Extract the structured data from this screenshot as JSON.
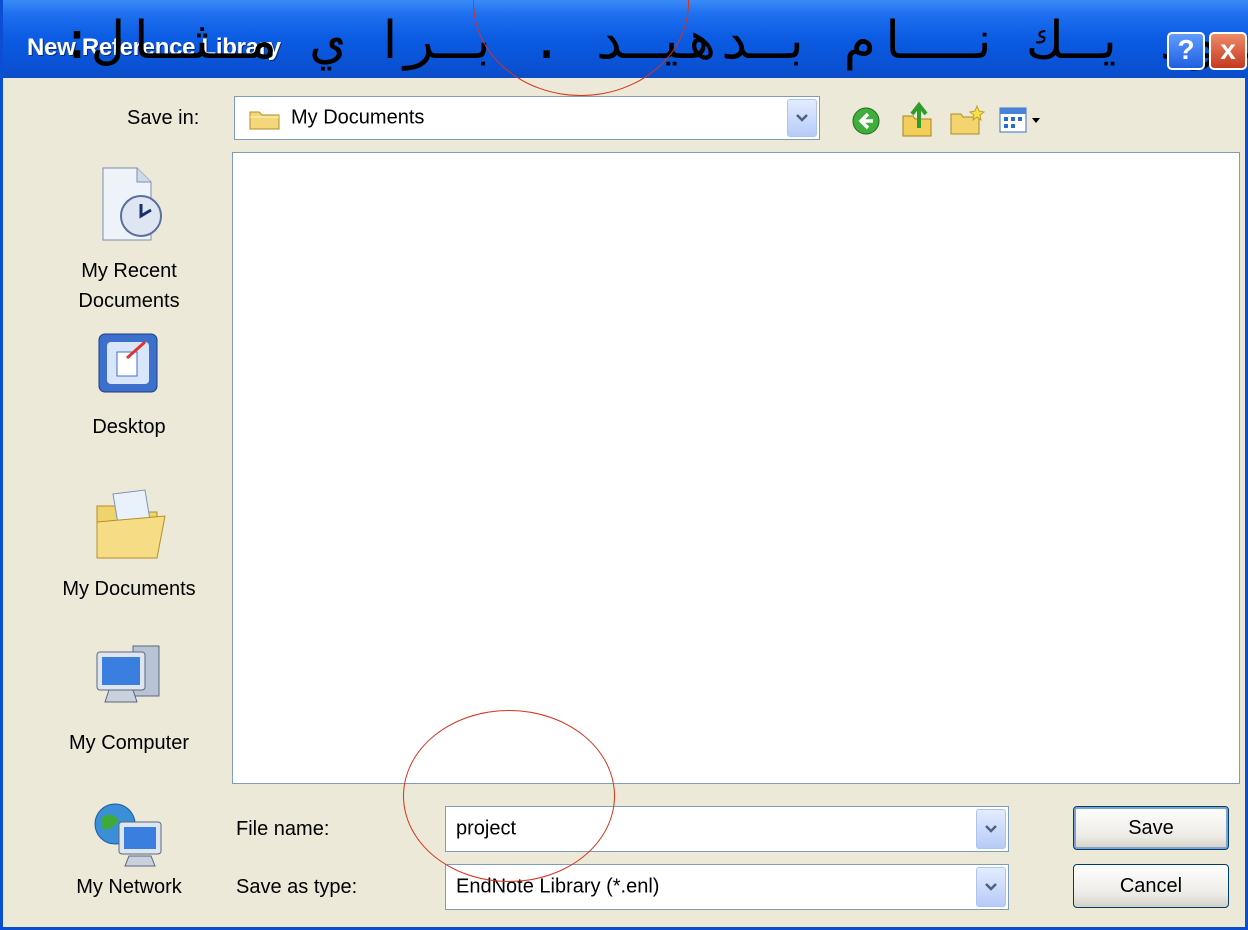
{
  "dialog": {
    "title": "New Reference Library",
    "overlay_text": "ـود يـك نــام بـدهيـد . بـرا ي مـثـال:"
  },
  "titlebar_buttons": {
    "help": "?",
    "close": "x"
  },
  "save_in": {
    "label": "Save in:",
    "value": "My Documents"
  },
  "toolbar_icons": [
    "back-icon",
    "up-folder-icon",
    "new-folder-icon",
    "views-menu-icon"
  ],
  "places": [
    {
      "label": "My Recent\nDocuments",
      "icon": "recent-documents-icon"
    },
    {
      "label": "Desktop",
      "icon": "desktop-icon"
    },
    {
      "label": "My Documents",
      "icon": "my-documents-icon"
    },
    {
      "label": "My Computer",
      "icon": "my-computer-icon"
    },
    {
      "label": "My Network",
      "icon": "my-network-icon"
    }
  ],
  "file_name": {
    "label": "File name:",
    "value": "project"
  },
  "save_as_type": {
    "label": "Save as type:",
    "value": "EndNote Library (*.enl)"
  },
  "buttons": {
    "save": "Save",
    "cancel": "Cancel"
  },
  "colors": {
    "titlebar": "#0a5be3",
    "dialog_bg": "#ece9d8",
    "annotation_circle": "#d8321b"
  }
}
